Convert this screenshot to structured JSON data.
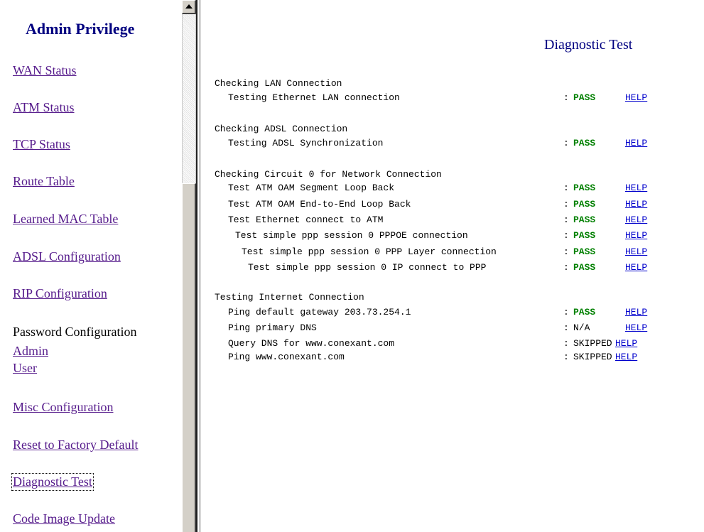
{
  "sidebar": {
    "title": "Admin Privilege",
    "items": [
      {
        "label": "WAN Status"
      },
      {
        "label": "ATM Status"
      },
      {
        "label": "TCP Status"
      },
      {
        "label": "Route Table"
      },
      {
        "label": "Learned MAC Table"
      },
      {
        "label": "ADSL Configuration"
      },
      {
        "label": "RIP Configuration"
      },
      {
        "label": "Password Configuration"
      },
      {
        "label": "Admin"
      },
      {
        "label": "User"
      },
      {
        "label": "Misc Configuration"
      },
      {
        "label": "Reset to Factory Default"
      },
      {
        "label": "Diagnostic Test"
      },
      {
        "label": "Code Image Update"
      }
    ]
  },
  "main": {
    "title": "Diagnostic Test",
    "help_label": "HELP",
    "colon": ":",
    "sections": [
      {
        "title": "Checking LAN Connection",
        "tests": [
          {
            "label": "Testing Ethernet LAN connection",
            "result": "PASS"
          }
        ]
      },
      {
        "title": "Checking ADSL Connection",
        "tests": [
          {
            "label": "Testing ADSL Synchronization",
            "result": "PASS"
          }
        ]
      },
      {
        "title": "Checking Circuit 0 for Network Connection",
        "tests": [
          {
            "label": "Test ATM OAM Segment Loop Back",
            "result": "PASS"
          },
          {
            "label": "Test ATM OAM End-to-End Loop Back",
            "result": "PASS"
          },
          {
            "label": "Test Ethernet connect to ATM",
            "result": "PASS"
          },
          {
            "label": "Test simple ppp session 0 PPPOE connection",
            "result": "PASS"
          },
          {
            "label": "Test simple ppp session 0 PPP Layer connection",
            "result": "PASS"
          },
          {
            "label": "Test simple ppp session 0 IP connect to PPP",
            "result": "PASS"
          }
        ]
      },
      {
        "title": "Testing Internet Connection",
        "tests": [
          {
            "label": "Ping default gateway 203.73.254.1",
            "result": "PASS"
          },
          {
            "label": "Ping primary DNS",
            "result": "N/A"
          },
          {
            "label": "Query DNS for www.conexant.com",
            "result": "SKIPPED"
          },
          {
            "label": "Ping www.conexant.com",
            "result": "SKIPPED"
          }
        ]
      }
    ]
  },
  "colors": {
    "pass": "#008000",
    "link": "#0000cc",
    "visited": "#551a8b",
    "title": "#000080"
  },
  "icons": {
    "scroll_up": "scroll-up-arrow-icon"
  }
}
